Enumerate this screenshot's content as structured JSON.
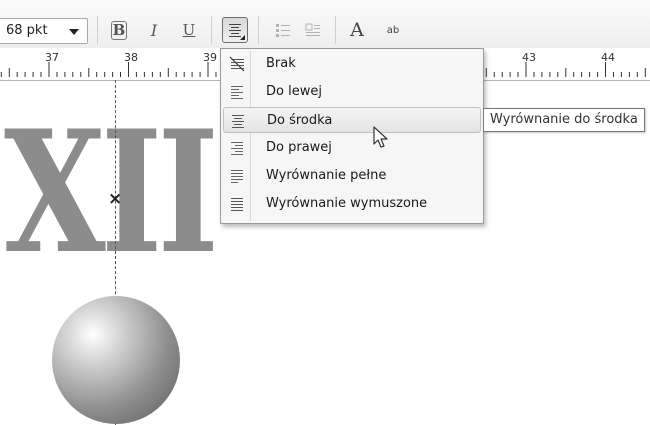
{
  "toolbar": {
    "font_size_value": "68 pkt",
    "buttons": [
      {
        "name": "bold-button",
        "glyph": "B"
      },
      {
        "name": "italic-button",
        "glyph": "I"
      },
      {
        "name": "underline-button",
        "glyph": "U"
      }
    ],
    "auto_text_glyph": "A",
    "spell_glyph": "ab"
  },
  "ruler": {
    "numbers": [
      "37",
      "38",
      "39",
      "43",
      "44"
    ]
  },
  "canvas": {
    "roman_text": "XII",
    "center_mark": "×"
  },
  "alignment_menu": {
    "items": [
      {
        "label": "Brak",
        "icon": "align-none-icon"
      },
      {
        "label": "Do lewej",
        "icon": "align-left-icon"
      },
      {
        "label": "Do środka",
        "icon": "align-center-icon",
        "hovered": true
      },
      {
        "label": "Do prawej",
        "icon": "align-right-icon"
      },
      {
        "label": "Wyrównanie pełne",
        "icon": "align-justify-icon"
      },
      {
        "label": "Wyrównanie wymuszone",
        "icon": "align-force-justify-icon"
      }
    ]
  },
  "tooltip": {
    "text": "Wyrównanie do środka"
  }
}
